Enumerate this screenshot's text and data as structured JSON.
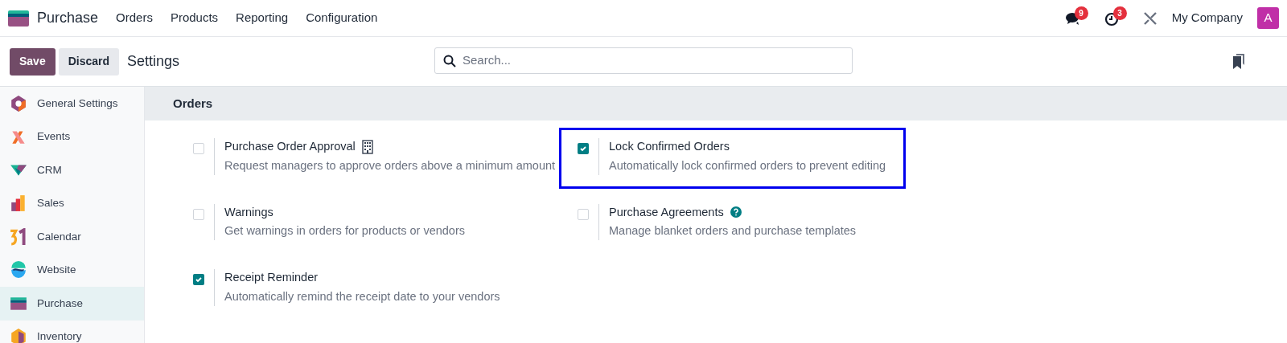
{
  "navbar": {
    "app": "Purchase",
    "menu": [
      "Orders",
      "Products",
      "Reporting",
      "Configuration"
    ],
    "messages_badge": "9",
    "activities_badge": "3",
    "company": "My Company",
    "avatar": "A"
  },
  "control_panel": {
    "buttons": [
      {
        "label": "Save",
        "kind": "primary"
      },
      {
        "label": "Discard",
        "kind": "secondary"
      }
    ],
    "title": "Settings",
    "search": {
      "placeholder": "Search..."
    }
  },
  "sidebar": {
    "items": [
      {
        "label": "General Settings",
        "kind": "general",
        "selected": false
      },
      {
        "label": "Events",
        "kind": "events",
        "selected": false
      },
      {
        "label": "CRM",
        "kind": "crm",
        "selected": false
      },
      {
        "label": "Sales",
        "kind": "sales",
        "selected": false
      },
      {
        "label": "Calendar",
        "kind": "calendar",
        "selected": false
      },
      {
        "label": "Website",
        "kind": "website",
        "selected": false
      },
      {
        "label": "Purchase",
        "kind": "purchase",
        "selected": true
      },
      {
        "label": "Inventory",
        "kind": "inventory",
        "selected": false
      }
    ]
  },
  "section": {
    "title": "Orders",
    "settings": [
      {
        "title": "Purchase Order Approval",
        "description": "Request managers to approve orders above a minimum amount",
        "checked": false,
        "kind": "building",
        "highlighted": false
      },
      {
        "title": "Lock Confirmed Orders",
        "description": "Automatically lock confirmed orders to prevent editing",
        "checked": true,
        "kind": "plain",
        "highlighted": true
      },
      {
        "title": "Warnings",
        "description": "Get warnings in orders for products or vendors",
        "checked": false,
        "kind": "plain",
        "highlighted": false
      },
      {
        "title": "Purchase Agreements",
        "description": "Manage blanket orders and purchase templates",
        "checked": false,
        "kind": "help",
        "highlighted": false
      },
      {
        "title": "Receipt Reminder",
        "description": "Automatically remind the receipt date to your vendors",
        "checked": true,
        "kind": "plain",
        "highlighted": false
      }
    ]
  }
}
